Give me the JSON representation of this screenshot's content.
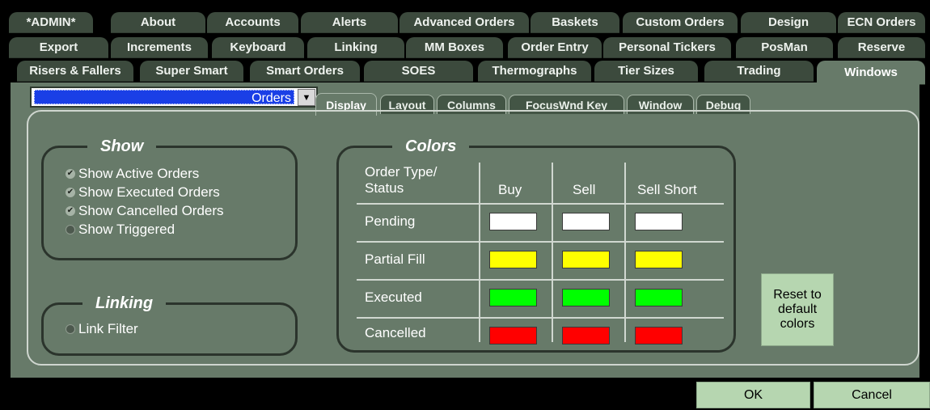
{
  "tabs": {
    "row1": [
      "*ADMIN*",
      "About",
      "Accounts",
      "Alerts",
      "Advanced Orders",
      "Baskets",
      "Custom Orders",
      "Design",
      "ECN Orders"
    ],
    "row2": [
      "Export",
      "Increments",
      "Keyboard",
      "Linking",
      "MM Boxes",
      "Order Entry",
      "Personal Tickers",
      "PosMan",
      "Reserve"
    ],
    "row3": [
      "Risers & Fallers",
      "Super Smart",
      "Smart Orders",
      "SOES",
      "Thermographs",
      "Tier Sizes",
      "Trading",
      "Windows"
    ]
  },
  "window_select": {
    "value": "Orders",
    "arrow_icon": "dropdown-arrow-icon"
  },
  "subtabs": [
    "Display",
    "Layout",
    "Columns",
    "FocusWnd Key",
    "Window",
    "Debug"
  ],
  "show": {
    "title": "Show",
    "options": [
      {
        "label": "Show Active Orders",
        "checked": true
      },
      {
        "label": "Show Executed Orders",
        "checked": true
      },
      {
        "label": "Show Cancelled Orders",
        "checked": true
      },
      {
        "label": "Show Triggered",
        "checked": false
      }
    ]
  },
  "linking": {
    "title": "Linking",
    "options": [
      {
        "label": "Link Filter",
        "checked": false
      }
    ]
  },
  "colors": {
    "title": "Colors",
    "header_type": "Order Type/\nStatus",
    "columns": [
      "Buy",
      "Sell",
      "Sell Short"
    ],
    "rows": [
      {
        "label": "Pending",
        "colors": [
          "#ffffff",
          "#ffffff",
          "#ffffff"
        ]
      },
      {
        "label": "Partial Fill",
        "colors": [
          "#ffff00",
          "#ffff00",
          "#ffff00"
        ]
      },
      {
        "label": "Executed",
        "colors": [
          "#00ff00",
          "#00ff00",
          "#00ff00"
        ]
      },
      {
        "label": "Cancelled",
        "colors": [
          "#ff0000",
          "#ff0000",
          "#ff0000"
        ]
      }
    ]
  },
  "reset_button": "Reset to default colors",
  "ok_button": "OK",
  "cancel_button": "Cancel"
}
